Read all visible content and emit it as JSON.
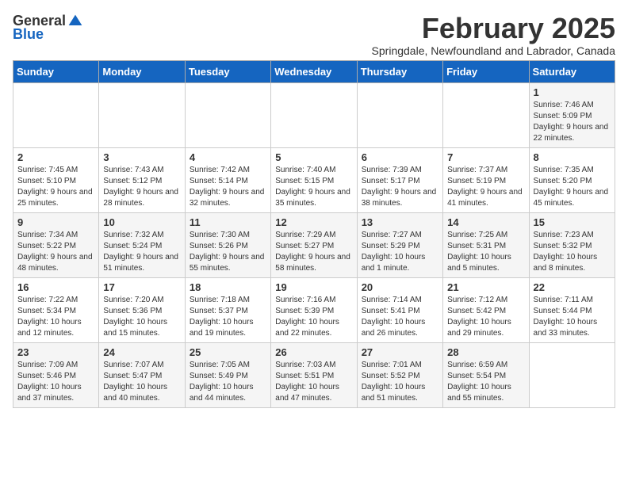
{
  "logo": {
    "general": "General",
    "blue": "Blue"
  },
  "header": {
    "month_title": "February 2025",
    "subtitle": "Springdale, Newfoundland and Labrador, Canada"
  },
  "weekdays": [
    "Sunday",
    "Monday",
    "Tuesday",
    "Wednesday",
    "Thursday",
    "Friday",
    "Saturday"
  ],
  "weeks": [
    [
      {
        "day": "",
        "info": ""
      },
      {
        "day": "",
        "info": ""
      },
      {
        "day": "",
        "info": ""
      },
      {
        "day": "",
        "info": ""
      },
      {
        "day": "",
        "info": ""
      },
      {
        "day": "",
        "info": ""
      },
      {
        "day": "1",
        "info": "Sunrise: 7:46 AM\nSunset: 5:09 PM\nDaylight: 9 hours and 22 minutes."
      }
    ],
    [
      {
        "day": "2",
        "info": "Sunrise: 7:45 AM\nSunset: 5:10 PM\nDaylight: 9 hours and 25 minutes."
      },
      {
        "day": "3",
        "info": "Sunrise: 7:43 AM\nSunset: 5:12 PM\nDaylight: 9 hours and 28 minutes."
      },
      {
        "day": "4",
        "info": "Sunrise: 7:42 AM\nSunset: 5:14 PM\nDaylight: 9 hours and 32 minutes."
      },
      {
        "day": "5",
        "info": "Sunrise: 7:40 AM\nSunset: 5:15 PM\nDaylight: 9 hours and 35 minutes."
      },
      {
        "day": "6",
        "info": "Sunrise: 7:39 AM\nSunset: 5:17 PM\nDaylight: 9 hours and 38 minutes."
      },
      {
        "day": "7",
        "info": "Sunrise: 7:37 AM\nSunset: 5:19 PM\nDaylight: 9 hours and 41 minutes."
      },
      {
        "day": "8",
        "info": "Sunrise: 7:35 AM\nSunset: 5:20 PM\nDaylight: 9 hours and 45 minutes."
      }
    ],
    [
      {
        "day": "9",
        "info": "Sunrise: 7:34 AM\nSunset: 5:22 PM\nDaylight: 9 hours and 48 minutes."
      },
      {
        "day": "10",
        "info": "Sunrise: 7:32 AM\nSunset: 5:24 PM\nDaylight: 9 hours and 51 minutes."
      },
      {
        "day": "11",
        "info": "Sunrise: 7:30 AM\nSunset: 5:26 PM\nDaylight: 9 hours and 55 minutes."
      },
      {
        "day": "12",
        "info": "Sunrise: 7:29 AM\nSunset: 5:27 PM\nDaylight: 9 hours and 58 minutes."
      },
      {
        "day": "13",
        "info": "Sunrise: 7:27 AM\nSunset: 5:29 PM\nDaylight: 10 hours and 1 minute."
      },
      {
        "day": "14",
        "info": "Sunrise: 7:25 AM\nSunset: 5:31 PM\nDaylight: 10 hours and 5 minutes."
      },
      {
        "day": "15",
        "info": "Sunrise: 7:23 AM\nSunset: 5:32 PM\nDaylight: 10 hours and 8 minutes."
      }
    ],
    [
      {
        "day": "16",
        "info": "Sunrise: 7:22 AM\nSunset: 5:34 PM\nDaylight: 10 hours and 12 minutes."
      },
      {
        "day": "17",
        "info": "Sunrise: 7:20 AM\nSunset: 5:36 PM\nDaylight: 10 hours and 15 minutes."
      },
      {
        "day": "18",
        "info": "Sunrise: 7:18 AM\nSunset: 5:37 PM\nDaylight: 10 hours and 19 minutes."
      },
      {
        "day": "19",
        "info": "Sunrise: 7:16 AM\nSunset: 5:39 PM\nDaylight: 10 hours and 22 minutes."
      },
      {
        "day": "20",
        "info": "Sunrise: 7:14 AM\nSunset: 5:41 PM\nDaylight: 10 hours and 26 minutes."
      },
      {
        "day": "21",
        "info": "Sunrise: 7:12 AM\nSunset: 5:42 PM\nDaylight: 10 hours and 29 minutes."
      },
      {
        "day": "22",
        "info": "Sunrise: 7:11 AM\nSunset: 5:44 PM\nDaylight: 10 hours and 33 minutes."
      }
    ],
    [
      {
        "day": "23",
        "info": "Sunrise: 7:09 AM\nSunset: 5:46 PM\nDaylight: 10 hours and 37 minutes."
      },
      {
        "day": "24",
        "info": "Sunrise: 7:07 AM\nSunset: 5:47 PM\nDaylight: 10 hours and 40 minutes."
      },
      {
        "day": "25",
        "info": "Sunrise: 7:05 AM\nSunset: 5:49 PM\nDaylight: 10 hours and 44 minutes."
      },
      {
        "day": "26",
        "info": "Sunrise: 7:03 AM\nSunset: 5:51 PM\nDaylight: 10 hours and 47 minutes."
      },
      {
        "day": "27",
        "info": "Sunrise: 7:01 AM\nSunset: 5:52 PM\nDaylight: 10 hours and 51 minutes."
      },
      {
        "day": "28",
        "info": "Sunrise: 6:59 AM\nSunset: 5:54 PM\nDaylight: 10 hours and 55 minutes."
      },
      {
        "day": "",
        "info": ""
      }
    ]
  ]
}
